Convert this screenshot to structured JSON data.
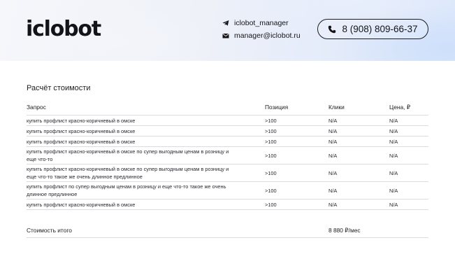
{
  "brand": {
    "logo_text": "iclobot"
  },
  "contacts": {
    "telegram": "iclobot_manager",
    "email": "manager@iclobot.ru",
    "phone": "8 (908) 809-66-37"
  },
  "section_title": "Расчёт стоимости",
  "table": {
    "headers": [
      "Запрос",
      "Позиция",
      "Клики",
      "Цена, ₽"
    ],
    "rows": [
      {
        "query": "купить профлист красно-коричневый в омске",
        "position": ">100",
        "clicks": "N/A",
        "price": "N/A"
      },
      {
        "query": "купить профлист красно-коричневый в омске",
        "position": ">100",
        "clicks": "N/A",
        "price": "N/A"
      },
      {
        "query": "купить профлист красно-коричневый в омске",
        "position": ">100",
        "clicks": "N/A",
        "price": "N/A"
      },
      {
        "query": "купить профлист красно-коричневый в омске по супер выгодным ценам в розницу и еще что-то",
        "position": ">100",
        "clicks": "N/A",
        "price": "N/A"
      },
      {
        "query": "купить профлист красно-коричневый в омске по супер выгодным ценам в розницу и еще что-то такое же очень длинное предлинное",
        "position": ">100",
        "clicks": "N/A",
        "price": "N/A"
      },
      {
        "query": "купить профлист по супер выгодным ценам в розницу и еще что-то такое же очень длинное предлинное",
        "position": ">100",
        "clicks": "N/A",
        "price": "N/A"
      },
      {
        "query": "купить профлист красно-коричневый в омске",
        "position": ">100",
        "clicks": "N/A",
        "price": "N/A"
      }
    ]
  },
  "total": {
    "label": "Стоимость итого",
    "value": "8 880 ₽/мес"
  }
}
